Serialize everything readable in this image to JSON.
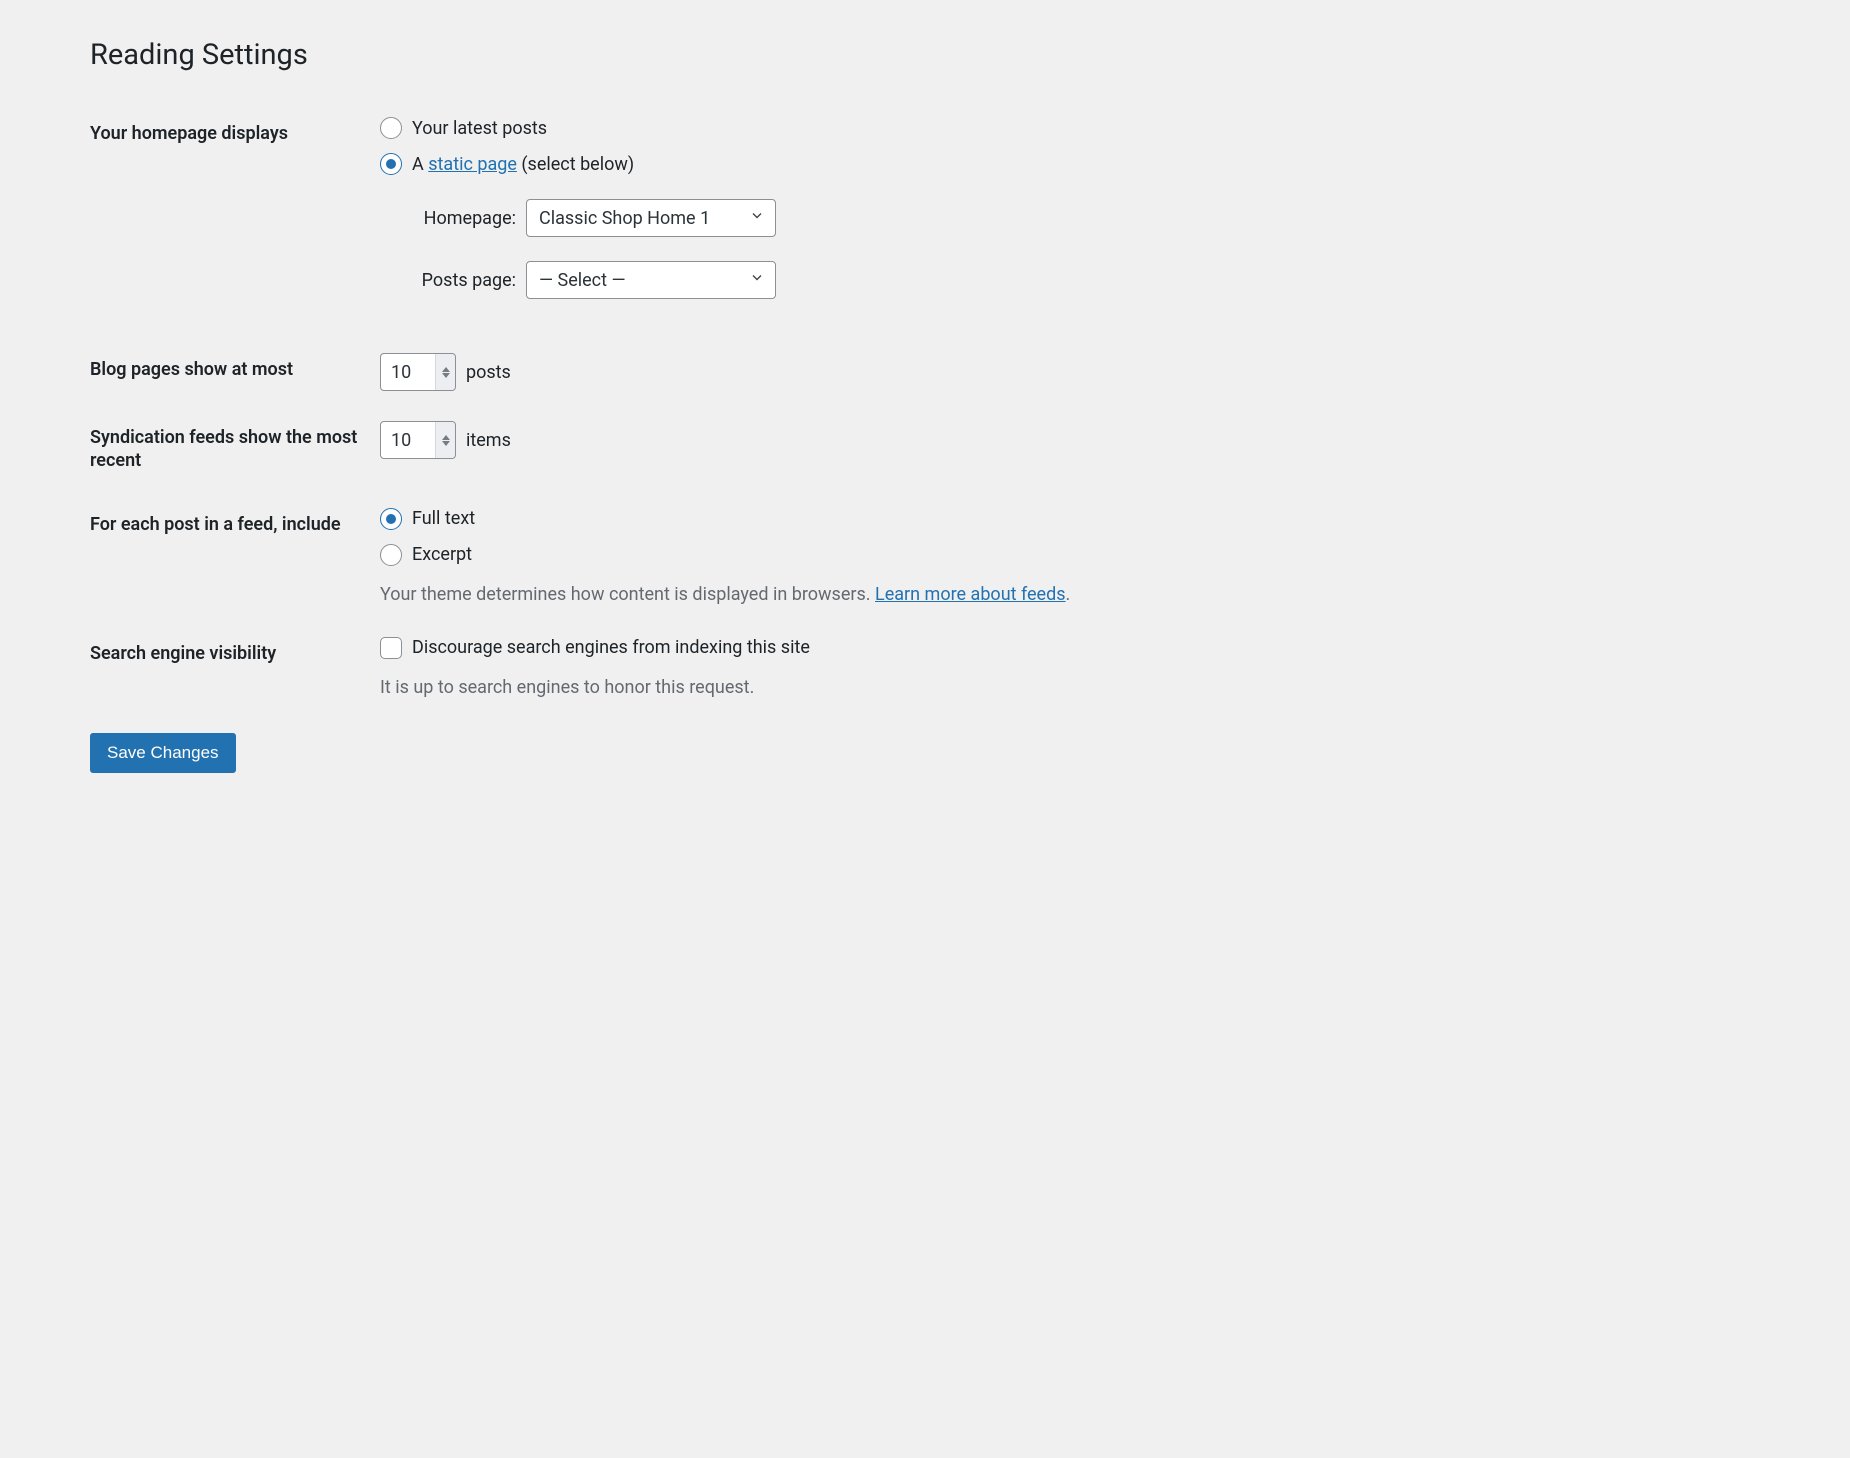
{
  "page": {
    "title": "Reading Settings"
  },
  "sections": {
    "homepage": {
      "label": "Your homepage displays",
      "options": {
        "latest": "Your latest posts",
        "static_prefix": "A ",
        "static_link": "static page",
        "static_suffix": " (select below)"
      },
      "homepage_select": {
        "label": "Homepage:",
        "value": "Classic Shop Home 1"
      },
      "posts_select": {
        "label": "Posts page:",
        "value": "— Select —"
      }
    },
    "blog_pages": {
      "label": "Blog pages show at most",
      "value": "10",
      "units": "posts"
    },
    "syndication": {
      "label": "Syndication feeds show the most recent",
      "value": "10",
      "units": "items"
    },
    "feed_content": {
      "label": "For each post in a feed, include",
      "options": {
        "full": "Full text",
        "excerpt": "Excerpt"
      },
      "description_prefix": "Your theme determines how content is displayed in browsers. ",
      "description_link": "Learn more about feeds",
      "description_suffix": "."
    },
    "search_visibility": {
      "label": "Search engine visibility",
      "checkbox_label": "Discourage search engines from indexing this site",
      "description": "It is up to search engines to honor this request."
    }
  },
  "actions": {
    "save": "Save Changes"
  }
}
